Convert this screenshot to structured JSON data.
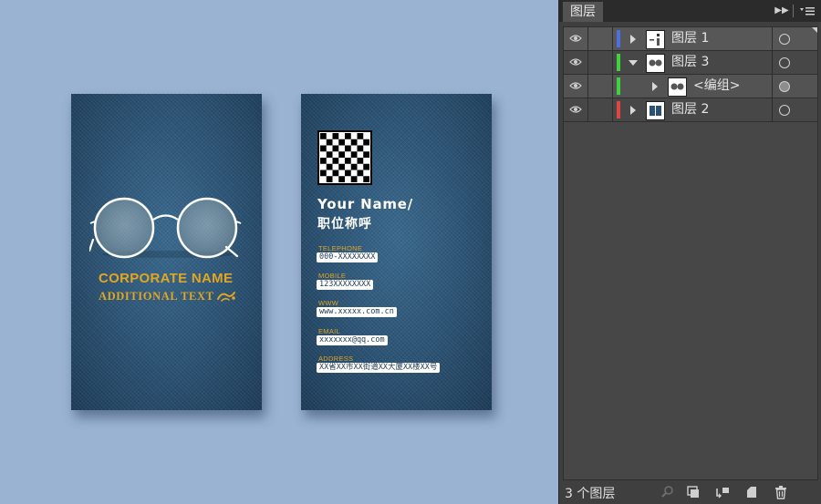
{
  "front_card": {
    "corporate_name": "CORPORATE NAME",
    "additional_text": "ADDITIONAL TEXT"
  },
  "back_card": {
    "name": "Your Name/",
    "position": "职位称呼",
    "fields": [
      {
        "label": "TELEPHONE",
        "value": "000-XXXXXXXX"
      },
      {
        "label": "MOBILE",
        "value": "123XXXXXXXX"
      },
      {
        "label": "WWW",
        "value": "www.xxxxx.com.cn"
      },
      {
        "label": "EMAIL",
        "value": "xxxxxxx@qq.com"
      },
      {
        "label": "ADDRESS",
        "value": "XX省XX市XX街道XX大厦XX楼XX号"
      }
    ]
  },
  "layers_panel": {
    "tab_label": "图层",
    "layers": [
      {
        "name": "图层 1",
        "color": "#4d6fe0",
        "expanded": false
      },
      {
        "name": "图层 3",
        "color": "#3fd13f",
        "expanded": true
      },
      {
        "name": "<编组>",
        "color": "#3fd13f",
        "expanded": false
      },
      {
        "name": "图层 2",
        "color": "#e04545",
        "expanded": false
      }
    ],
    "footer": {
      "layer_count": "3 个图层"
    }
  },
  "colors": {
    "accent_gold": "#e2a623",
    "denim": "#2b5273",
    "panel_bg": "#474747"
  }
}
